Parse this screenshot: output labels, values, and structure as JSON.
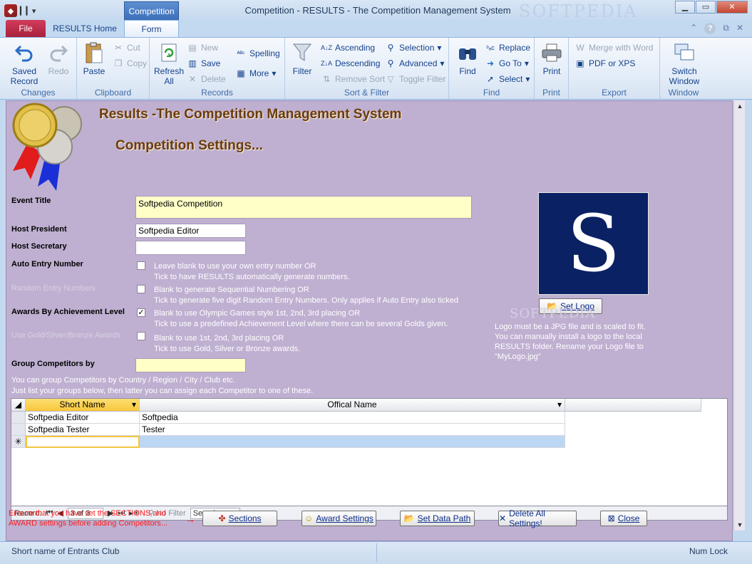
{
  "titlebar": {
    "context_tab": "Competition",
    "title": "Competition  -  RESULTS - The Competition Management System",
    "watermark": "SOFTPEDIA"
  },
  "ribbon_tabs": {
    "file": "File",
    "home": "RESULTS Home",
    "form": "Form"
  },
  "ribbon": {
    "changes": {
      "label": "Changes",
      "saved_record": "Saved Record",
      "redo": "Redo"
    },
    "clipboard": {
      "label": "Clipboard",
      "paste": "Paste",
      "cut": "Cut",
      "copy": "Copy"
    },
    "records": {
      "label": "Records",
      "refresh_all": "Refresh All",
      "new": "New",
      "save": "Save",
      "delete": "Delete",
      "spelling": "Spelling",
      "more": "More"
    },
    "sort_filter": {
      "label": "Sort & Filter",
      "filter": "Filter",
      "ascending": "Ascending",
      "descending": "Descending",
      "remove_sort": "Remove Sort",
      "selection": "Selection",
      "advanced": "Advanced",
      "toggle_filter": "Toggle Filter"
    },
    "find": {
      "label": "Find",
      "find": "Find",
      "replace": "Replace",
      "go_to": "Go To",
      "select": "Select"
    },
    "print": {
      "label": "Print",
      "print": "Print"
    },
    "export": {
      "label": "Export",
      "merge_word": "Merge with Word",
      "pdf_xps": "PDF or XPS"
    },
    "window": {
      "label": "Window",
      "switch_window": "Switch Window"
    }
  },
  "form": {
    "header1": "Results -The Competition Management System",
    "header2": "Competition Settings...",
    "event_title_label": "Event Title",
    "event_title_value": "Softpedia Competition",
    "host_president_label": "Host President",
    "host_president_value": "Softpedia Editor",
    "host_secretary_label": "Host Secretary",
    "host_secretary_value": "",
    "auto_entry_label": "Auto Entry Number",
    "auto_entry_help1": "Leave blank to use your own entry number OR",
    "auto_entry_help2": "Tick to have RESULTS automatically generate numbers.",
    "random_entry_label": "Random Entry Numbers",
    "random_entry_help1": "Blank to generate Sequential Numbering OR",
    "random_entry_help2": "Tick to generate five digit Random Entry Numbers. Only applies if Auto Entry also ticked",
    "awards_label": "Awards By Achievement Level",
    "awards_help1": "Blank to use Olympic Games style  1st, 2nd, 3rd  placing  OR",
    "awards_help2": "Tick to use a predefined Achievement Level where there can be several Golds given.",
    "gsb_label": "Use Gold/Silver/Bronze Awards",
    "gsb_help1": "Blank to use  1st, 2nd, 3rd  placing  OR",
    "gsb_help2": "Tick to use Gold, Silver or Bronze awards.",
    "group_label": "Group Competitors by",
    "group_value": "",
    "group_help1": "You can group Competitors by Country / Region / City / Club etc.",
    "group_help2": "Just list your groups below, then latter you can assign each Competitor to one of these.",
    "logo_letter": "S",
    "set_logo": "Set Logo",
    "logo_note": "Logo must be a JPG file and is scaled to fit. You can manually install a logo to the local RESULTS folder. Rename your Logo file to \"MyLogo.jpg\"",
    "logo_watermark": "SOFTPEDIA"
  },
  "datasheet": {
    "col_short": "Short Name",
    "col_official": "Offical Name",
    "rows": [
      {
        "short": "Softpedia Editor",
        "official": "Softpedia"
      },
      {
        "short": "Softpedia Tester",
        "official": "Tester"
      }
    ],
    "new_row_marker": "✳"
  },
  "navbar": {
    "record_label": "Record:",
    "position": "3 of 3",
    "no_filter": "No Filter",
    "search": "Search"
  },
  "footer": {
    "warning1": "Ensure that you have set the SECTIONS and",
    "warning2": "AWARD settings before adding Competitors...",
    "sections": "Sections",
    "award_settings": "Award Settings",
    "set_data_path": "Set Data Path",
    "delete_all": "Delete All Settings!",
    "close": "Close"
  },
  "status": {
    "left": "Short name of Entrants Club",
    "right": "Num Lock"
  }
}
